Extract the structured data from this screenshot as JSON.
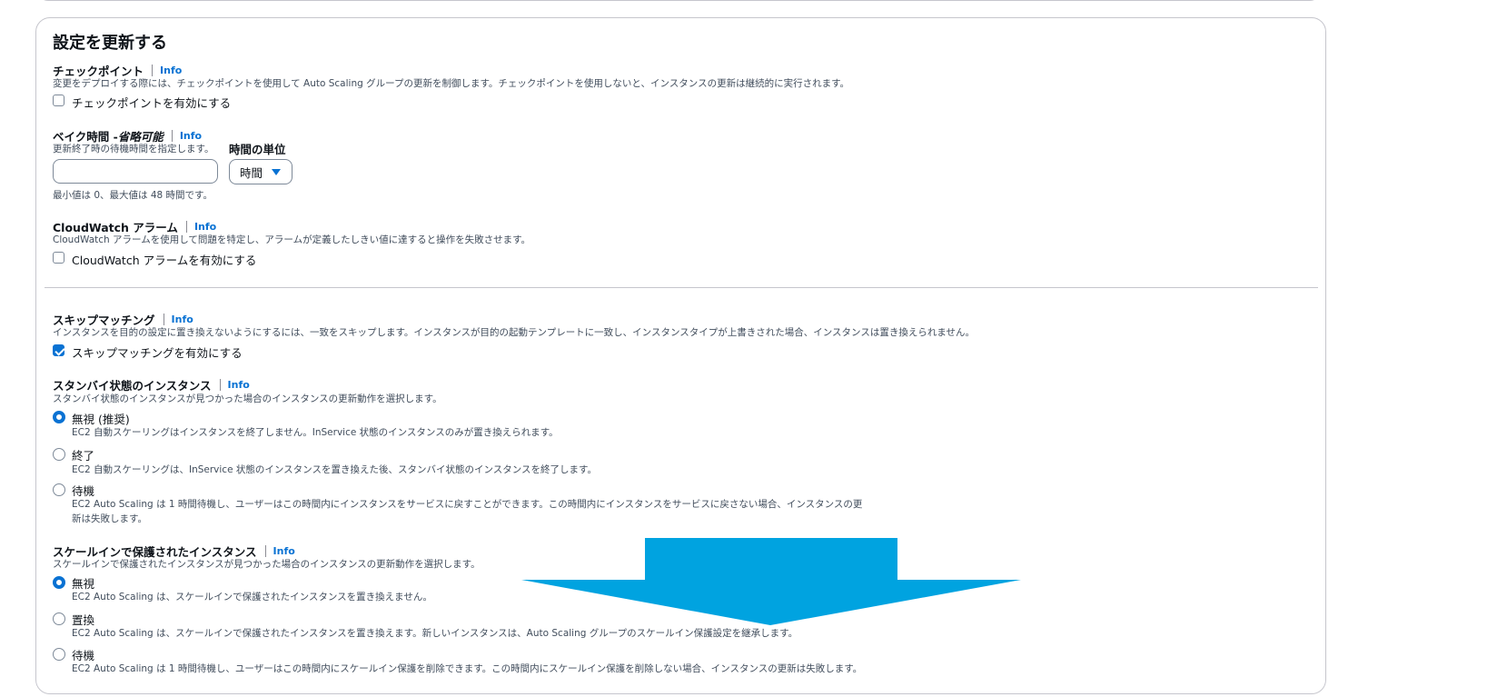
{
  "section": {
    "title": "設定を更新する",
    "info_label": "Info"
  },
  "checkpoint": {
    "label": "チェックポイント",
    "description": "変更をデプロイする際には、チェックポイントを使用して Auto Scaling グループの更新を制御します。チェックポイントを使用しないと、インスタンスの更新は継続的に実行されます。",
    "checkbox_label": "チェックポイントを有効にする",
    "checked": false
  },
  "bake_time": {
    "label": "ベイク時間 - ",
    "label_optional": "省略可能",
    "description": "更新終了時の待機時間を指定します。",
    "value": "",
    "hint": "最小値は 0、最大値は 48 時間です。",
    "unit_label": "時間の単位",
    "unit_value": "時間"
  },
  "cloudwatch": {
    "label": "CloudWatch アラーム",
    "description": "CloudWatch アラームを使用して問題を特定し、アラームが定義したしきい値に達すると操作を失敗させます。",
    "checkbox_label": "CloudWatch アラームを有効にする",
    "checked": false
  },
  "skip_matching": {
    "label": "スキップマッチング",
    "description": "インスタンスを目的の設定に置き換えないようにするには、一致をスキップします。インスタンスが目的の起動テンプレートに一致し、インスタンスタイプが上書きされた場合、インスタンスは置き換えられません。",
    "checkbox_label": "スキップマッチングを有効にする",
    "checked": true
  },
  "standby": {
    "label": "スタンバイ状態のインスタンス",
    "description": "スタンバイ状態のインスタンスが見つかった場合のインスタンスの更新動作を選択します。",
    "options": [
      {
        "label": "無視 (推奨)",
        "desc": "EC2 自動スケーリングはインスタンスを終了しません。InService 状態のインスタンスのみが置き換えられます。",
        "selected": true
      },
      {
        "label": "終了",
        "desc": "EC2 自動スケーリングは、InService 状態のインスタンスを置き換えた後、スタンバイ状態のインスタンスを終了します。",
        "selected": false
      },
      {
        "label": "待機",
        "desc": "EC2 Auto Scaling は 1 時間待機し、ユーザーはこの時間内にインスタンスをサービスに戻すことができます。この時間内にインスタンスをサービスに戻さない場合、インスタンスの更",
        "desc2": "新は失敗します。",
        "selected": false
      }
    ]
  },
  "scale_in": {
    "label": "スケールインで保護されたインスタンス",
    "description": "スケールインで保護されたインスタンスが見つかった場合のインスタンスの更新動作を選択します。",
    "options": [
      {
        "label": "無視",
        "desc": "EC2 Auto Scaling は、スケールインで保護されたインスタンスを置き換えません。",
        "selected": true
      },
      {
        "label": "置換",
        "desc": "EC2 Auto Scaling は、スケールインで保護されたインスタンスを置き換えます。新しいインスタンスは、Auto Scaling グループのスケールイン保護設定を継承します。",
        "selected": false
      },
      {
        "label": "待機",
        "desc": "EC2 Auto Scaling は 1 時間待機し、ユーザーはこの時間内にスケールイン保護を削除できます。この時間内にスケールイン保護を削除しない場合、インスタンスの更新は失敗します。",
        "selected": false
      }
    ]
  },
  "annotation": {
    "color": "#00a3e0",
    "icon": "arrow-down-icon"
  }
}
